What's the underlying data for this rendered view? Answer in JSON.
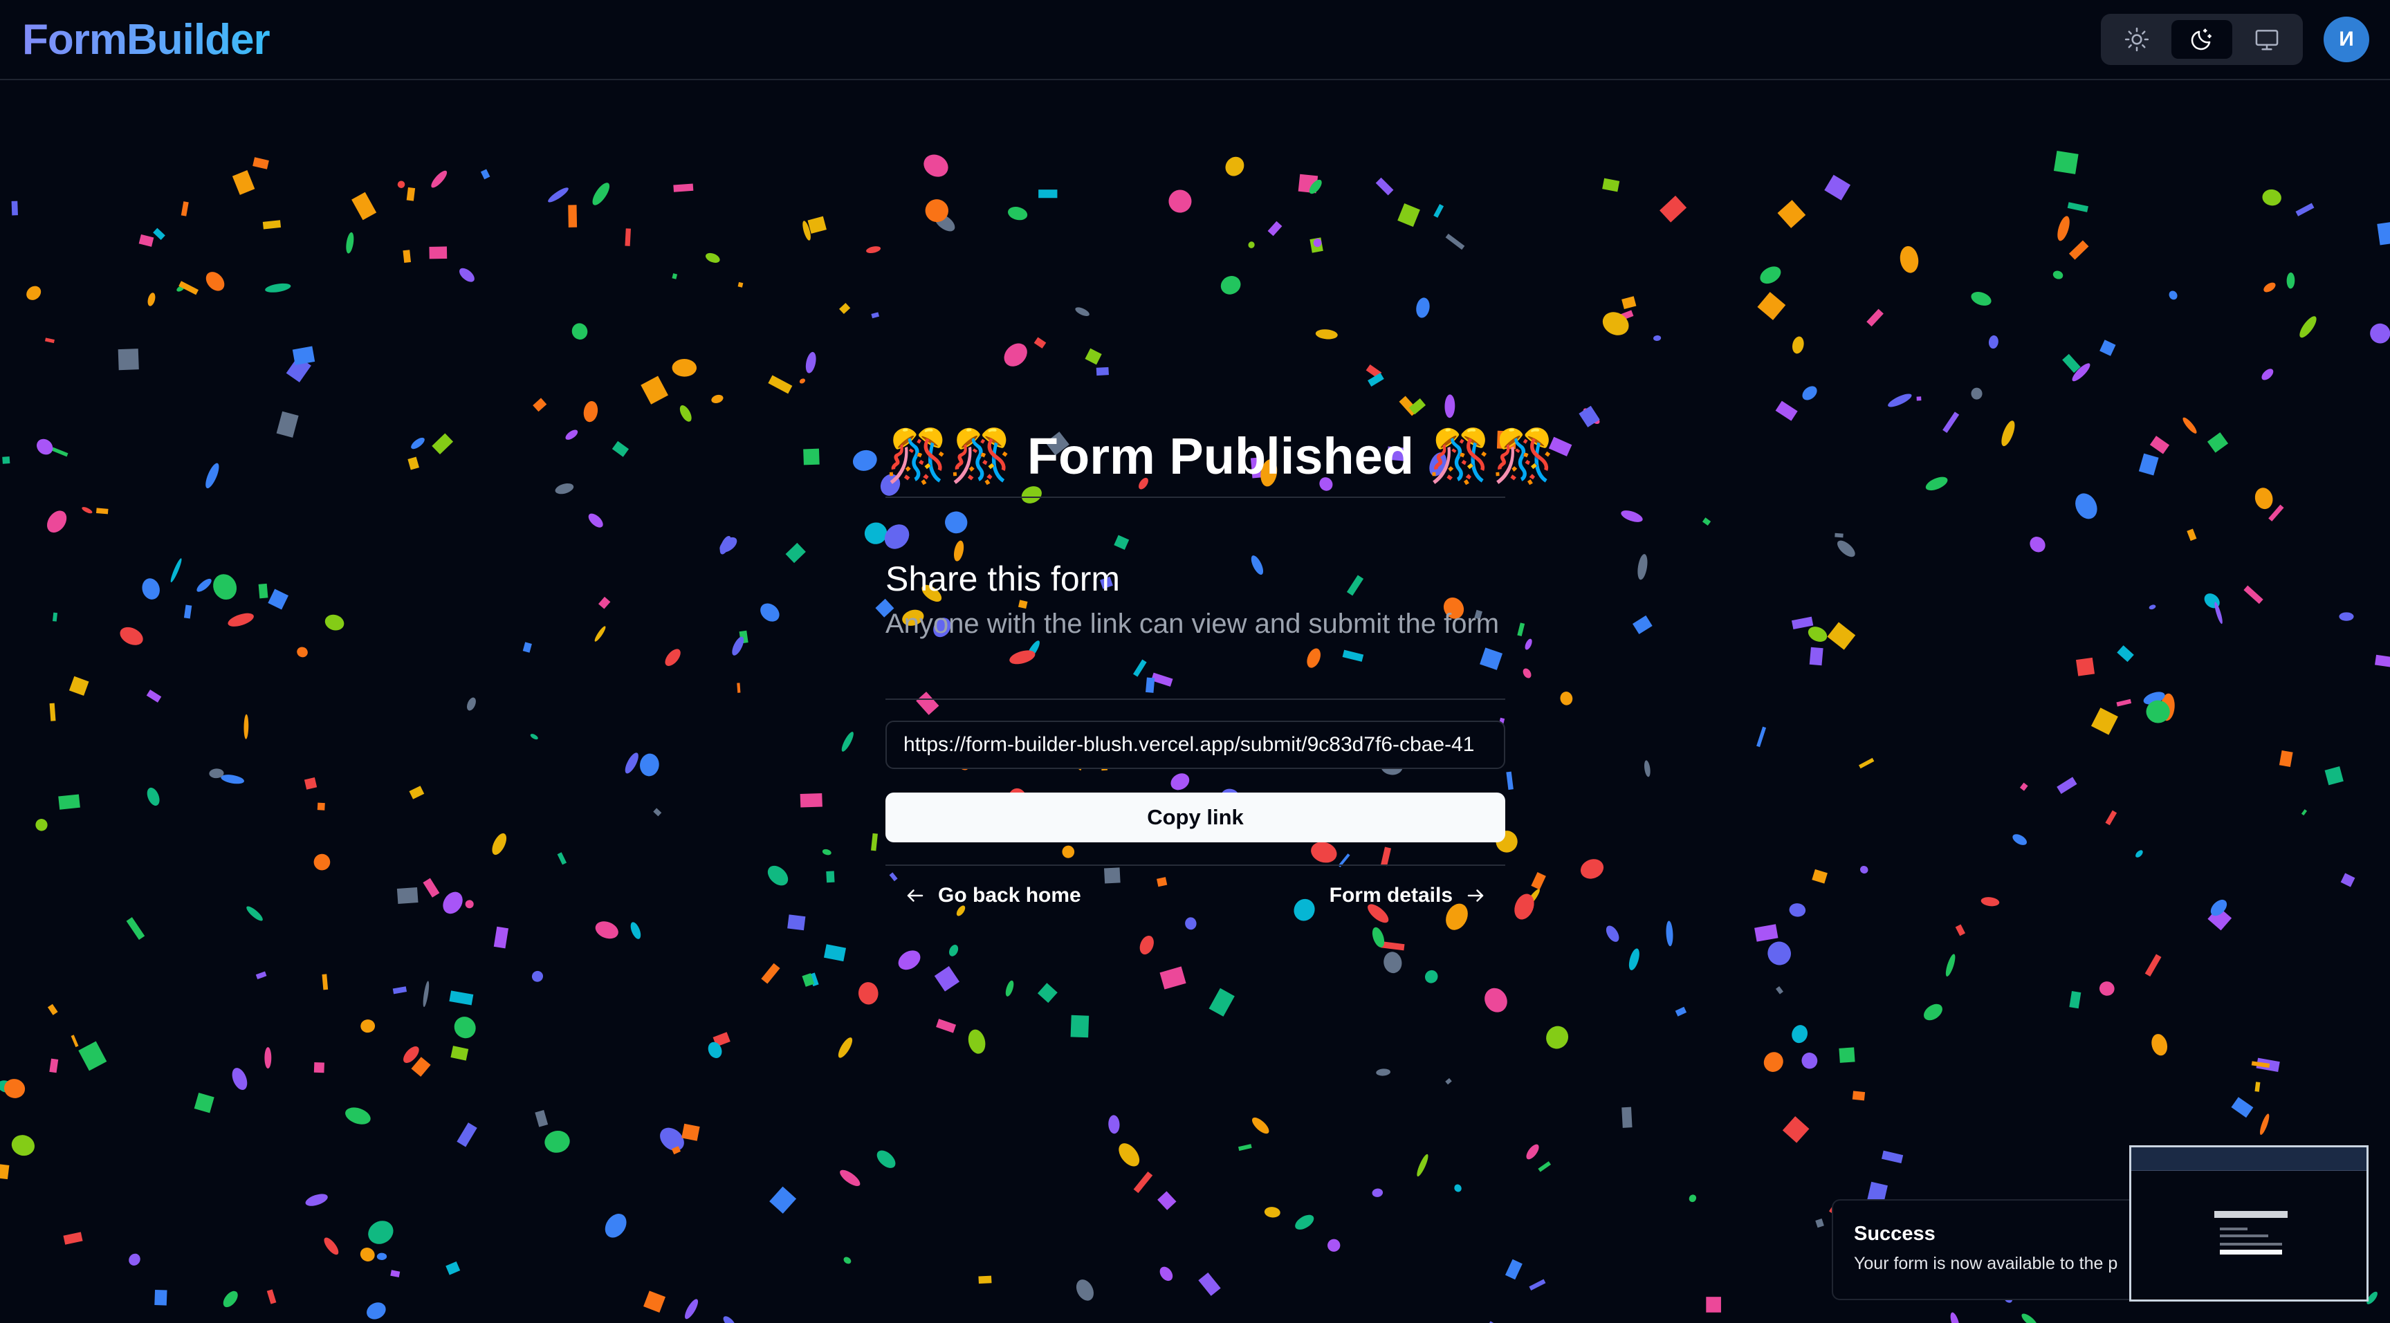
{
  "app": {
    "logo": "FormBuilder",
    "avatar_initial": "И",
    "theme_options": [
      {
        "name": "light",
        "icon": "sun-icon",
        "active": false
      },
      {
        "name": "dark",
        "icon": "moon-stars-icon",
        "active": true
      },
      {
        "name": "system",
        "icon": "monitor-icon",
        "active": false
      }
    ]
  },
  "main": {
    "title": "🎊🎊 Form Published 🎊🎊",
    "share_heading": "Share this form",
    "share_description": "Anyone with the link can view and submit the form",
    "share_url": "https://form-builder-blush.vercel.app/submit/9c83d7f6-cbae-41",
    "copy_button": "Copy link",
    "go_back_home": "Go back home",
    "form_details": "Form details"
  },
  "toast": {
    "title": "Success",
    "description": "Your form is now available to the p"
  },
  "colors": {
    "background": "#030712",
    "logo_gradient_start": "#818cf8",
    "logo_gradient_end": "#38bdf8",
    "avatar": "#2f7fd6",
    "muted_text": "#9ca3af"
  }
}
